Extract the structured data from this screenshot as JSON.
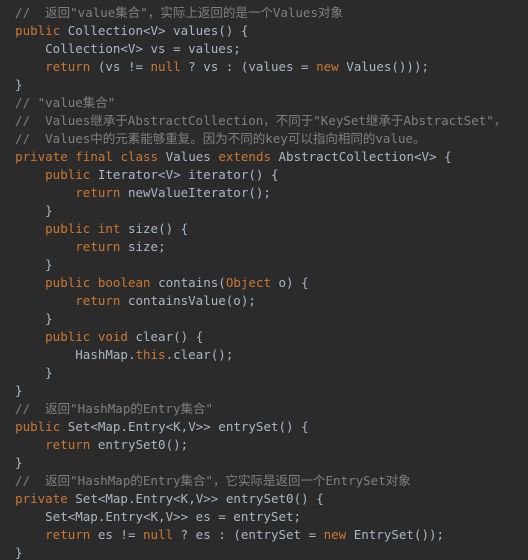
{
  "code": {
    "c1": "  //  返回\"value集合\"，实际上返回的是一个Values对象",
    "l2_kw_public": "public",
    "l2_type": " Collection<V> ",
    "l2_name": "values",
    "l2_rest": "() {",
    "l3": "      Collection<V> vs = values;",
    "l4_kw_return": "return",
    "l4_a": " (vs != ",
    "l4_kw_null": "null",
    "l4_b": " ? vs : (values = ",
    "l4_kw_new": "new",
    "l4_c": " Values()));",
    "l5": "  }",
    "c2": "  // \"value集合\"",
    "c3": "  //  Values继承于AbstractCollection，不同于\"KeySet继承于AbstractSet\"，",
    "c4": "  //  Values中的元素能够重复。因为不同的key可以指向相同的value。",
    "l9_kw_private": "private",
    "l9_kw_final": "final",
    "l9_kw_class": "class",
    "l9_a": " Values ",
    "l9_kw_extends": "extends",
    "l9_b": " AbstractCollection<V> {",
    "l10_kw_public": "public",
    "l10_a": " Iterator<V> ",
    "l10_name": "iterator",
    "l10_b": "() {",
    "l11_kw_return": "return",
    "l11_a": " newValueIterator();",
    "l12": "      }",
    "l13_kw_public": "public",
    "l13_kw_int": "int",
    "l13_name": "size",
    "l13_a": "() {",
    "l14_kw_return": "return",
    "l14_name": "size",
    "l14_a": ";",
    "l15": "      }",
    "l16_kw_public": "public",
    "l16_kw_boolean": "boolean",
    "l16_name": "contains",
    "l16_a": "(",
    "l16_obj": "Object",
    "l16_b": " o) {",
    "l17_kw_return": "return",
    "l17_a": " containsValue(o);",
    "l18": "      }",
    "l19_kw_public": "public",
    "l19_kw_void": "void",
    "l19_name": "clear",
    "l19_a": "() {",
    "l20_cls": "HashMap",
    "l20_dot1": ".",
    "l20_kw_this": "this",
    "l20_dot2": ".",
    "l20_name": "clear",
    "l20_a": "();",
    "l21": "      }",
    "l22": "  }",
    "c5": "  //  返回\"HashMap的Entry集合\"",
    "l24_kw_public": "public",
    "l24_a": " Set<Map",
    "l24_d1": ".",
    "l24_b": "Entry<K",
    "l24_d2": ",",
    "l24_c": "V>> ",
    "l24_name": "entrySet",
    "l24_e": "() {",
    "l25_kw_return": "return",
    "l25_a": " entrySet0();",
    "l26": "  }",
    "c6": "  //  返回\"HashMap的Entry集合\"，它实际是返回一个EntrySet对象",
    "l28_kw_private": "private",
    "l28_a": " Set<Map",
    "l28_d1": ".",
    "l28_b": "Entry<K",
    "l28_d2": ",",
    "l28_c": "V>> ",
    "l28_name": "entrySet0",
    "l28_e": "() {",
    "l29": "      Set<Map.Entry<K,V>> es = entrySet;",
    "l30_kw_return": "return",
    "l30_a": " es != ",
    "l30_kw_null": "null",
    "l30_b": " ? es : (entrySet = ",
    "l30_kw_new": "new",
    "l30_c": " EntrySet());",
    "l31": "  }"
  }
}
